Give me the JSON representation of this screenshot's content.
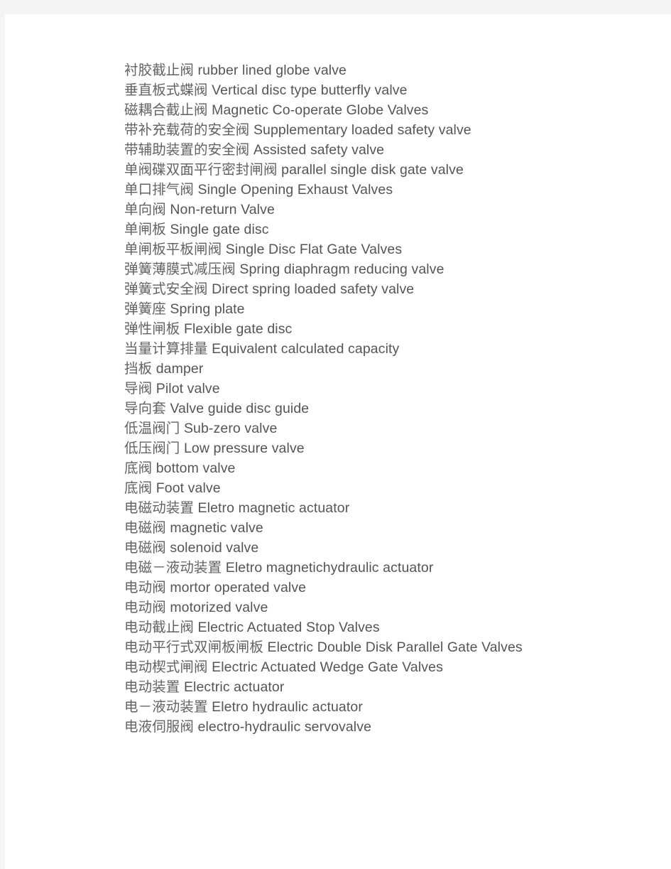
{
  "document": {
    "type": "glossary",
    "page_background": "#f4f4f4",
    "paper_background": "#ffffff",
    "text_color": "#595959",
    "entries": [
      {
        "term": "衬胶截止阀",
        "gloss": "rubber lined globe valve"
      },
      {
        "term": "垂直板式蝶阀",
        "gloss": "Vertical disc type butterfly valve"
      },
      {
        "term": "磁耦合截止阀",
        "gloss": "Magnetic Co-operate Globe Valves"
      },
      {
        "term": "带补充载荷的安全阀",
        "gloss": "Supplementary loaded safety valve"
      },
      {
        "term": "带辅助装置的安全阀",
        "gloss": "Assisted safety valve"
      },
      {
        "term": "单阀碟双面平行密封闸阀",
        "gloss": "parallel single disk gate valve"
      },
      {
        "term": "单口排气阀",
        "gloss": "Single Opening Exhaust Valves"
      },
      {
        "term": "单向阀",
        "gloss": "Non-return Valve"
      },
      {
        "term": "单闸板",
        "gloss": "Single gate disc"
      },
      {
        "term": "单闸板平板闸阀",
        "gloss": "Single Disc Flat Gate Valves"
      },
      {
        "term": "弹簧薄膜式减压阀",
        "gloss": "Spring diaphragm reducing valve"
      },
      {
        "term": "弹簧式安全阀",
        "gloss": "Direct spring loaded safety valve"
      },
      {
        "term": "弹簧座",
        "gloss": "Spring plate"
      },
      {
        "term": "弹性闸板",
        "gloss": "Flexible gate disc"
      },
      {
        "term": "当量计算排量",
        "gloss": "Equivalent calculated capacity"
      },
      {
        "term": "挡板",
        "gloss": "damper"
      },
      {
        "term": "导阀",
        "gloss": "Pilot valve"
      },
      {
        "term": "导向套",
        "gloss": "Valve guide disc guide"
      },
      {
        "term": "低温阀门",
        "gloss": "Sub-zero valve"
      },
      {
        "term": "低压阀门",
        "gloss": "Low pressure valve"
      },
      {
        "term": "底阀",
        "gloss": "bottom valve"
      },
      {
        "term": "底阀",
        "gloss": "Foot valve"
      },
      {
        "term": "电磁动装置",
        "gloss": "Eletro magnetic actuator"
      },
      {
        "term": "电磁阀",
        "gloss": "magnetic valve"
      },
      {
        "term": "电磁阀",
        "gloss": "solenoid valve"
      },
      {
        "term": "电磁－液动装置",
        "gloss": "Eletro magnetichydraulic actuator"
      },
      {
        "term": "电动阀",
        "gloss": "mortor operated valve"
      },
      {
        "term": "电动阀",
        "gloss": "motorized valve"
      },
      {
        "term": "电动截止阀",
        "gloss": "Electric Actuated Stop Valves"
      },
      {
        "term": "电动平行式双闸板闸板",
        "gloss": "Electric Double Disk Parallel Gate Valves"
      },
      {
        "term": "电动楔式闸阀",
        "gloss": "Electric Actuated Wedge Gate Valves"
      },
      {
        "term": "电动装置",
        "gloss": "Electric actuator"
      },
      {
        "term": "电－液动装置",
        "gloss": "Eletro hydraulic actuator"
      },
      {
        "term": "电液伺服阀",
        "gloss": "electro-hydraulic servovalve"
      }
    ]
  }
}
